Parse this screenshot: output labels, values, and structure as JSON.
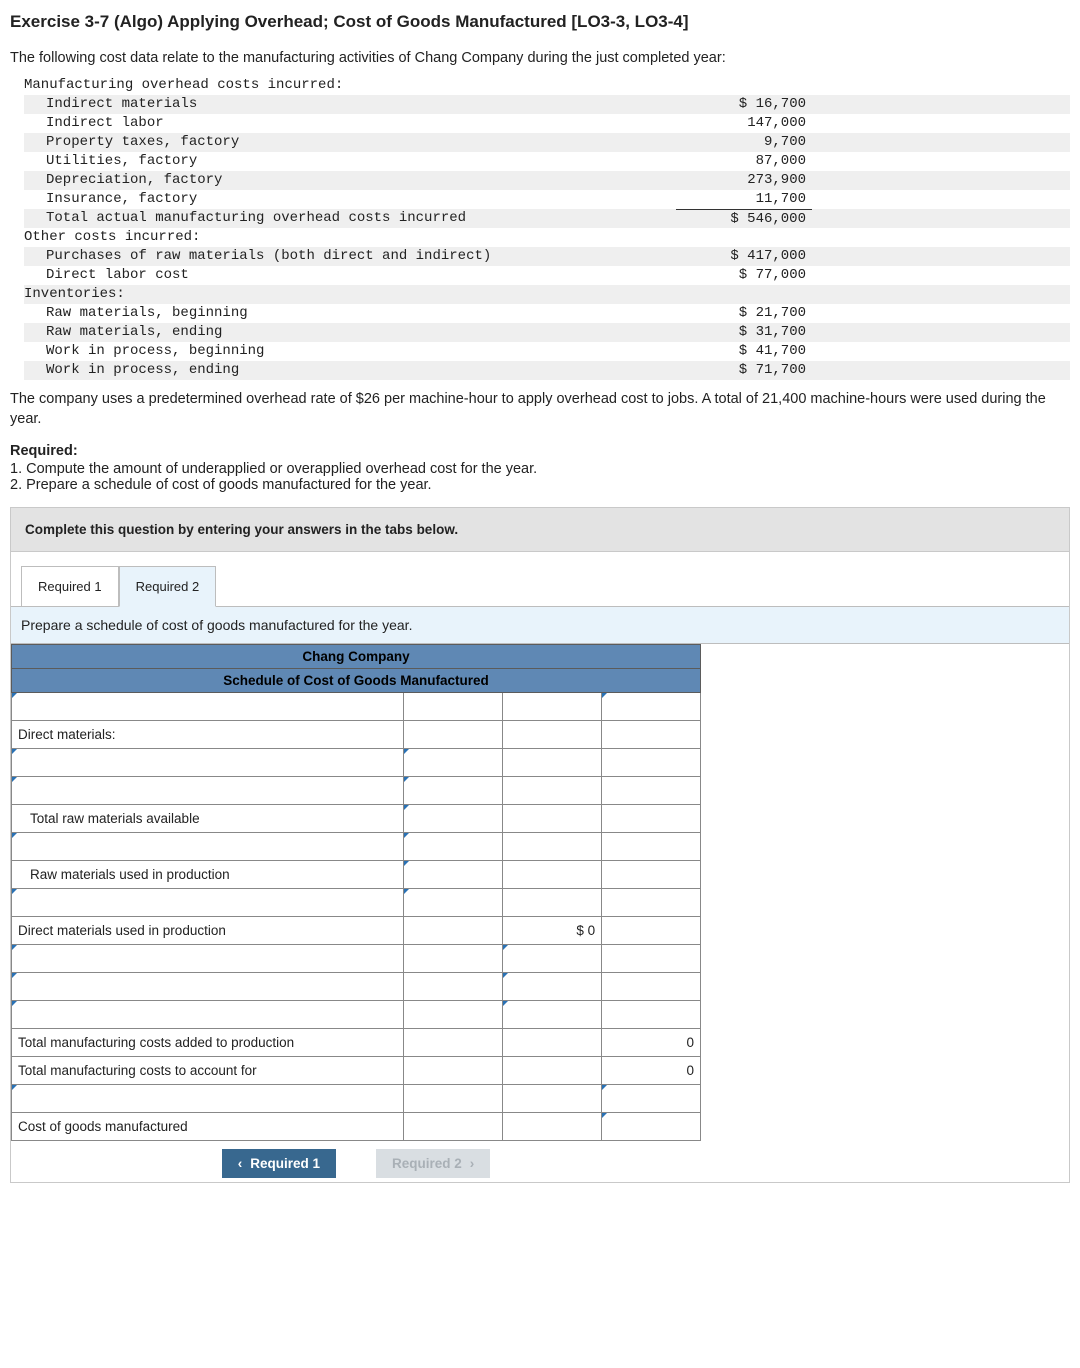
{
  "title": "Exercise 3-7 (Algo) Applying Overhead; Cost of Goods Manufactured [LO3-3, LO3-4]",
  "intro": "The following cost data relate to the manufacturing activities of Chang Company during the just completed year:",
  "mono": {
    "h1": "Manufacturing overhead costs incurred:",
    "r1": {
      "l": "Indirect materials",
      "v": "$ 16,700"
    },
    "r2": {
      "l": "Indirect labor",
      "v": "147,000"
    },
    "r3": {
      "l": "Property taxes, factory",
      "v": "9,700"
    },
    "r4": {
      "l": "Utilities, factory",
      "v": "87,000"
    },
    "r5": {
      "l": "Depreciation, factory",
      "v": "273,900"
    },
    "r6": {
      "l": "Insurance, factory",
      "v": "11,700"
    },
    "r7": {
      "l": "Total actual manufacturing overhead costs incurred",
      "v": "$ 546,000"
    },
    "h2": "Other costs incurred:",
    "r8": {
      "l": "Purchases of raw materials (both direct and indirect)",
      "v": "$ 417,000"
    },
    "r9": {
      "l": "Direct labor cost",
      "v": "$ 77,000"
    },
    "h3": "Inventories:",
    "r10": {
      "l": "Raw materials, beginning",
      "v": "$ 21,700"
    },
    "r11": {
      "l": "Raw materials, ending",
      "v": "$ 31,700"
    },
    "r12": {
      "l": "Work in process, beginning",
      "v": "$ 41,700"
    },
    "r13": {
      "l": "Work in process, ending",
      "v": "$ 71,700"
    }
  },
  "para2": "The company uses a predetermined overhead rate of $26 per machine-hour to apply overhead cost to jobs. A total of 21,400 machine-hours were used during the year.",
  "required": {
    "head": "Required:",
    "i1": "1. Compute the amount of underapplied or overapplied overhead cost for the year.",
    "i2": "2. Prepare a schedule of cost of goods manufactured for the year."
  },
  "answer": {
    "instr": "Complete this question by entering your answers in the tabs below.",
    "tab1": "Required 1",
    "tab2": "Required 2",
    "sub": "Prepare a schedule of cost of goods manufactured for the year."
  },
  "sched": {
    "h1": "Chang Company",
    "h2": "Schedule of Cost of Goods Manufactured",
    "rows": {
      "dm": "Direct materials:",
      "trma": "Total raw materials available",
      "rmup": "Raw materials used in production",
      "dmup": "Direct materials used in production",
      "dmup_val": "$             0",
      "tmcap": "Total manufacturing costs added to production",
      "tmcaf": "Total manufacturing costs to account for",
      "zero": "0",
      "cogm": "Cost of goods manufactured"
    }
  },
  "nav": {
    "prev": "Required 1",
    "next": "Required 2"
  }
}
